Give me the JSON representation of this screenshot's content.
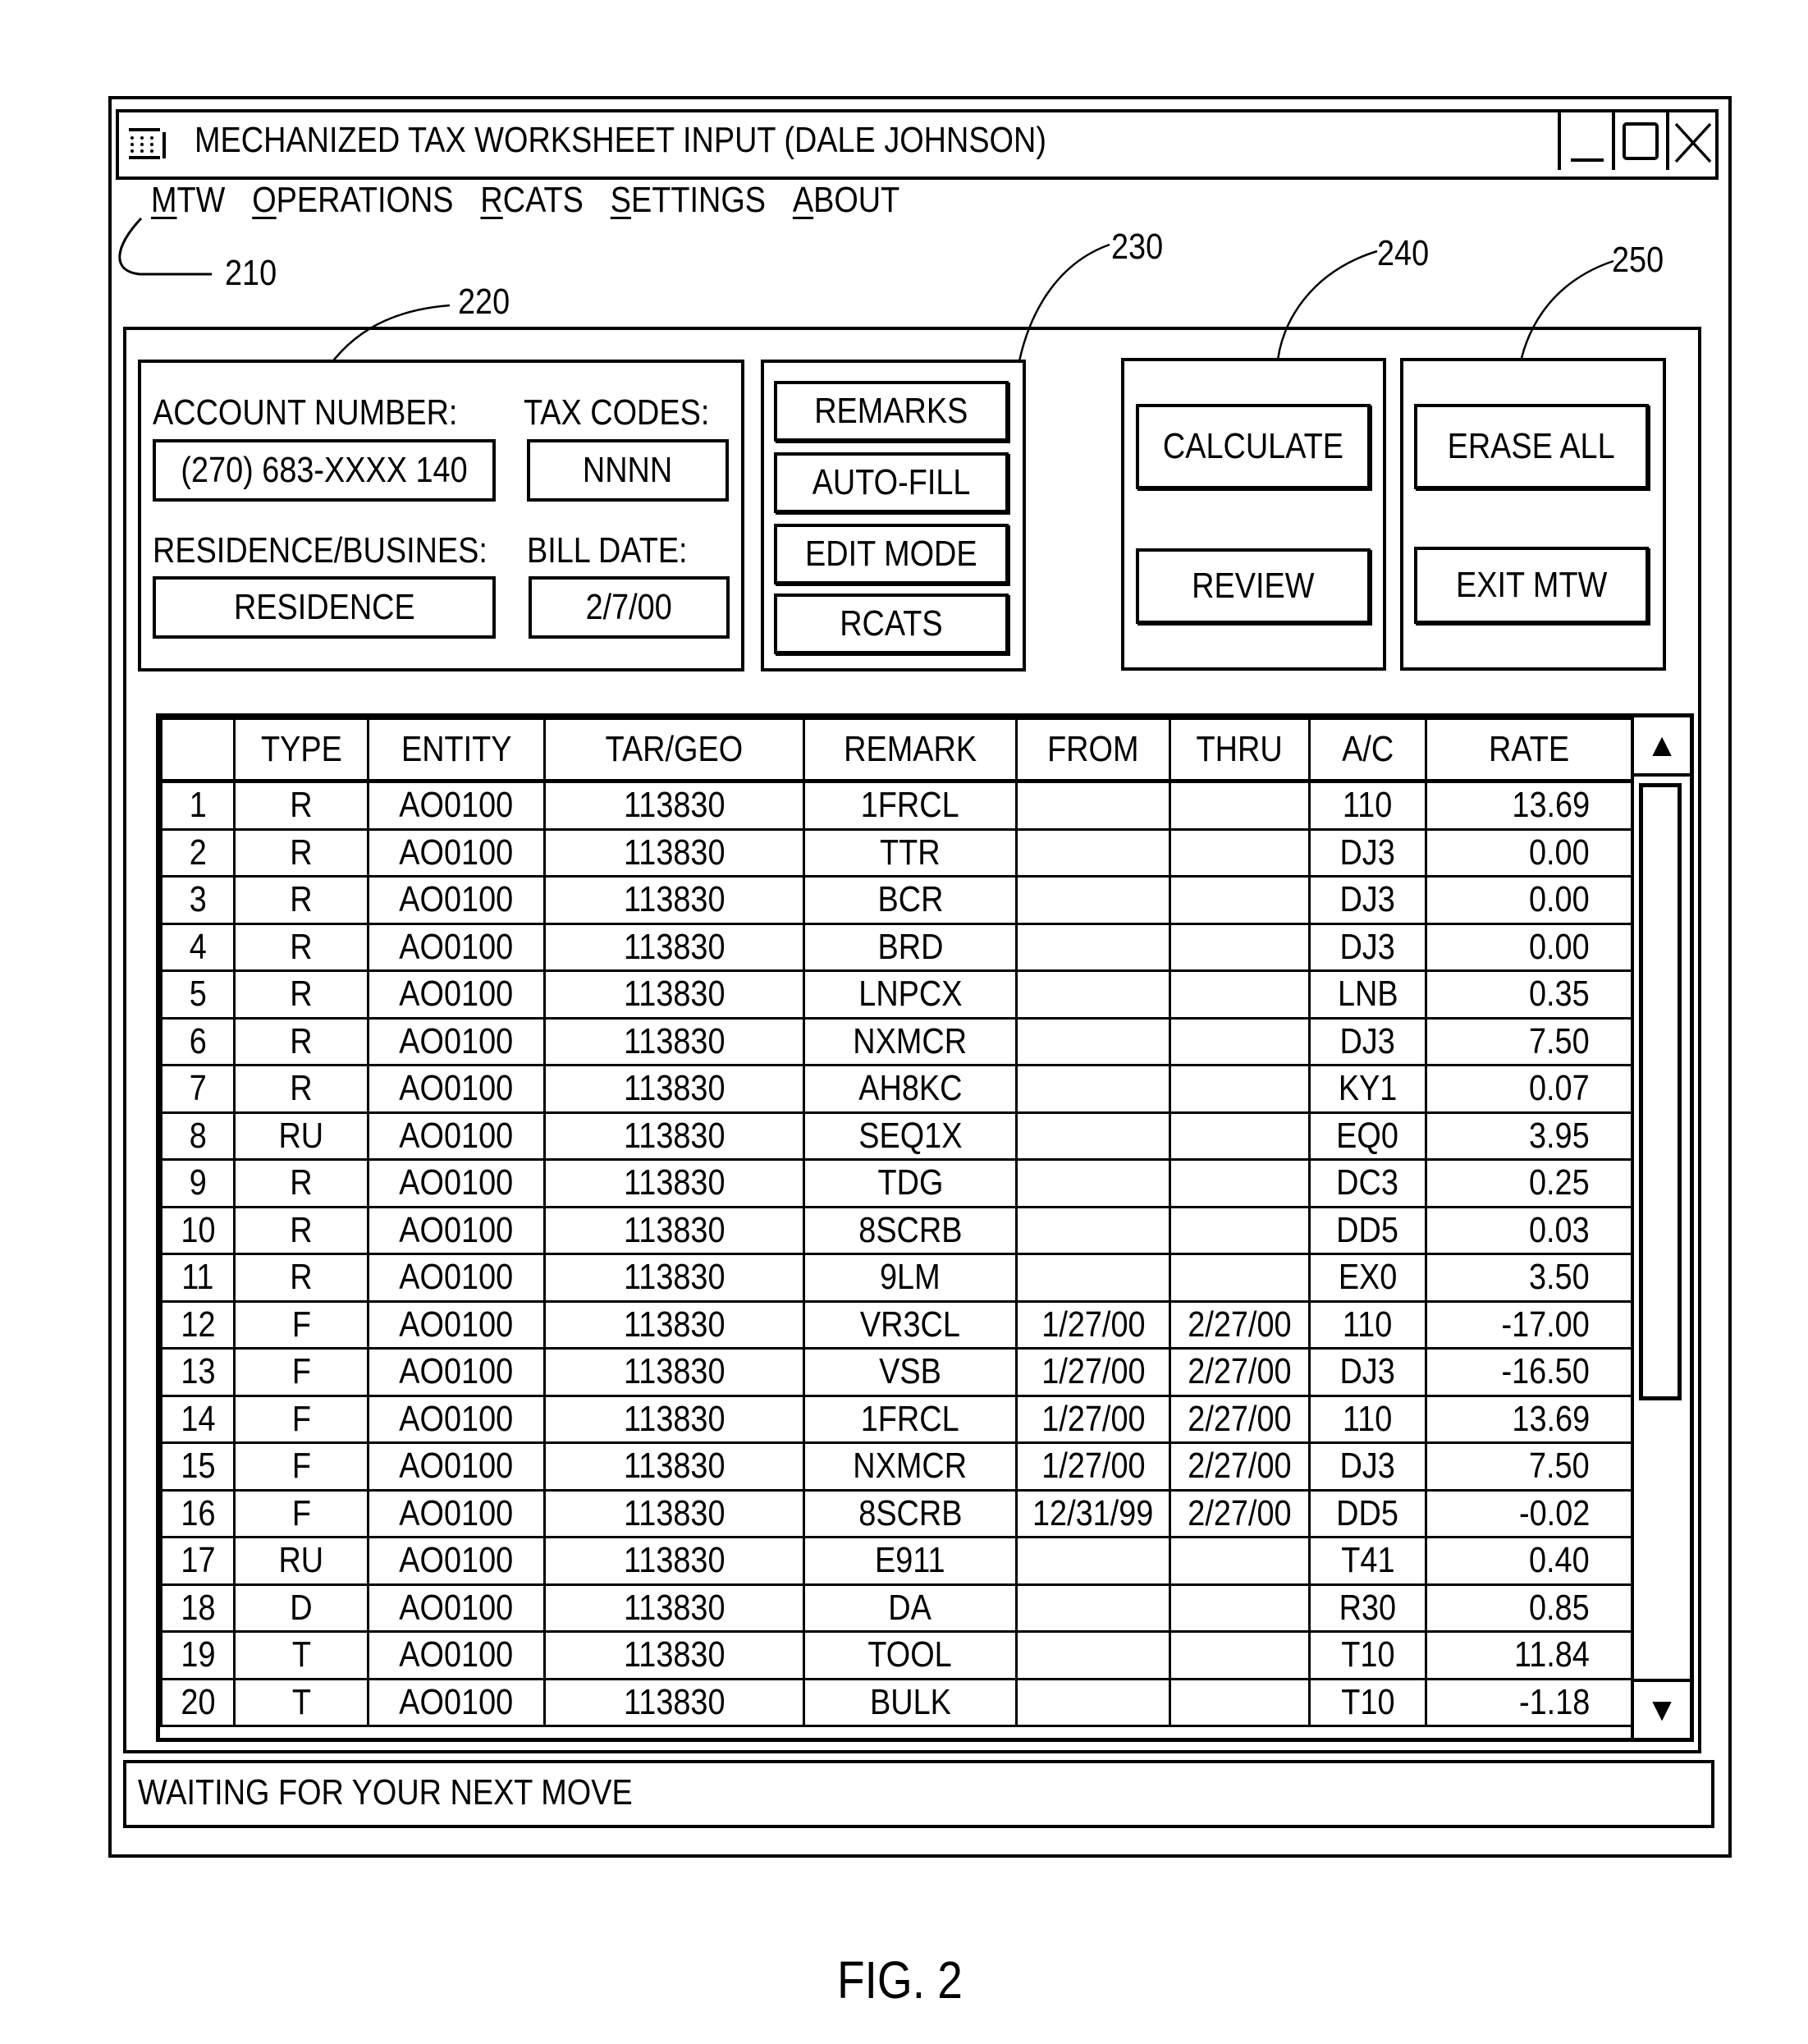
{
  "window": {
    "title": "MECHANIZED TAX WORKSHEET INPUT (DALE JOHNSON)",
    "icon": "app-grid-icon",
    "controls": [
      "minimize-icon",
      "maximize-icon",
      "close-icon"
    ]
  },
  "menu": {
    "items": [
      {
        "accel": "M",
        "rest": "TW"
      },
      {
        "accel": "O",
        "rest": "PERATIONS"
      },
      {
        "accel": "R",
        "rest": "CATS"
      },
      {
        "accel": "S",
        "rest": "ETTINGS"
      },
      {
        "accel": "A",
        "rest": "BOUT"
      }
    ]
  },
  "ref_numbers": {
    "menu": "210",
    "account_panel": "220",
    "function_buttons": "230",
    "calc_panel": "240",
    "exit_panel": "250"
  },
  "account": {
    "account_number_label": "ACCOUNT NUMBER:",
    "account_number_value": "(270) 683-XXXX 140",
    "tax_codes_label": "TAX CODES:",
    "tax_codes_value": "NNNN",
    "res_bus_label": "RESIDENCE/BUSINES:",
    "res_bus_value": "RESIDENCE",
    "bill_date_label": "BILL DATE:",
    "bill_date_value": "2/7/00"
  },
  "function_buttons": [
    "REMARKS",
    "AUTO-FILL",
    "EDIT MODE",
    "RCATS"
  ],
  "calc_buttons": {
    "calculate": "CALCULATE",
    "review": "REVIEW"
  },
  "exit_buttons": {
    "erase_all": "ERASE ALL",
    "exit": "EXIT MTW"
  },
  "table": {
    "columns": [
      "",
      "TYPE",
      "ENTITY",
      "TAR/GEO",
      "REMARK",
      "FROM",
      "THRU",
      "A/C",
      "RATE"
    ],
    "rows": [
      [
        "1",
        "R",
        "AO0100",
        "113830",
        "1FRCL",
        "",
        "",
        "110",
        "13.69"
      ],
      [
        "2",
        "R",
        "AO0100",
        "113830",
        "TTR",
        "",
        "",
        "DJ3",
        "0.00"
      ],
      [
        "3",
        "R",
        "AO0100",
        "113830",
        "BCR",
        "",
        "",
        "DJ3",
        "0.00"
      ],
      [
        "4",
        "R",
        "AO0100",
        "113830",
        "BRD",
        "",
        "",
        "DJ3",
        "0.00"
      ],
      [
        "5",
        "R",
        "AO0100",
        "113830",
        "LNPCX",
        "",
        "",
        "LNB",
        "0.35"
      ],
      [
        "6",
        "R",
        "AO0100",
        "113830",
        "NXMCR",
        "",
        "",
        "DJ3",
        "7.50"
      ],
      [
        "7",
        "R",
        "AO0100",
        "113830",
        "AH8KC",
        "",
        "",
        "KY1",
        "0.07"
      ],
      [
        "8",
        "RU",
        "AO0100",
        "113830",
        "SEQ1X",
        "",
        "",
        "EQ0",
        "3.95"
      ],
      [
        "9",
        "R",
        "AO0100",
        "113830",
        "TDG",
        "",
        "",
        "DC3",
        "0.25"
      ],
      [
        "10",
        "R",
        "AO0100",
        "113830",
        "8SCRB",
        "",
        "",
        "DD5",
        "0.03"
      ],
      [
        "11",
        "R",
        "AO0100",
        "113830",
        "9LM",
        "",
        "",
        "EX0",
        "3.50"
      ],
      [
        "12",
        "F",
        "AO0100",
        "113830",
        "VR3CL",
        "1/27/00",
        "2/27/00",
        "110",
        "-17.00"
      ],
      [
        "13",
        "F",
        "AO0100",
        "113830",
        "VSB",
        "1/27/00",
        "2/27/00",
        "DJ3",
        "-16.50"
      ],
      [
        "14",
        "F",
        "AO0100",
        "113830",
        "1FRCL",
        "1/27/00",
        "2/27/00",
        "110",
        "13.69"
      ],
      [
        "15",
        "F",
        "AO0100",
        "113830",
        "NXMCR",
        "1/27/00",
        "2/27/00",
        "DJ3",
        "7.50"
      ],
      [
        "16",
        "F",
        "AO0100",
        "113830",
        "8SCRB",
        "12/31/99",
        "2/27/00",
        "DD5",
        "-0.02"
      ],
      [
        "17",
        "RU",
        "AO0100",
        "113830",
        "E911",
        "",
        "",
        "T41",
        "0.40"
      ],
      [
        "18",
        "D",
        "AO0100",
        "113830",
        "DA",
        "",
        "",
        "R30",
        "0.85"
      ],
      [
        "19",
        "T",
        "AO0100",
        "113830",
        "TOOL",
        "",
        "",
        "T10",
        "11.84"
      ],
      [
        "20",
        "T",
        "AO0100",
        "113830",
        "BULK",
        "",
        "",
        "T10",
        "-1.18"
      ]
    ],
    "scroll_up_glyph": "▲",
    "scroll_down_glyph": "▼"
  },
  "status": {
    "text": "WAITING FOR YOUR NEXT MOVE"
  },
  "figure_label": "FIG. 2"
}
